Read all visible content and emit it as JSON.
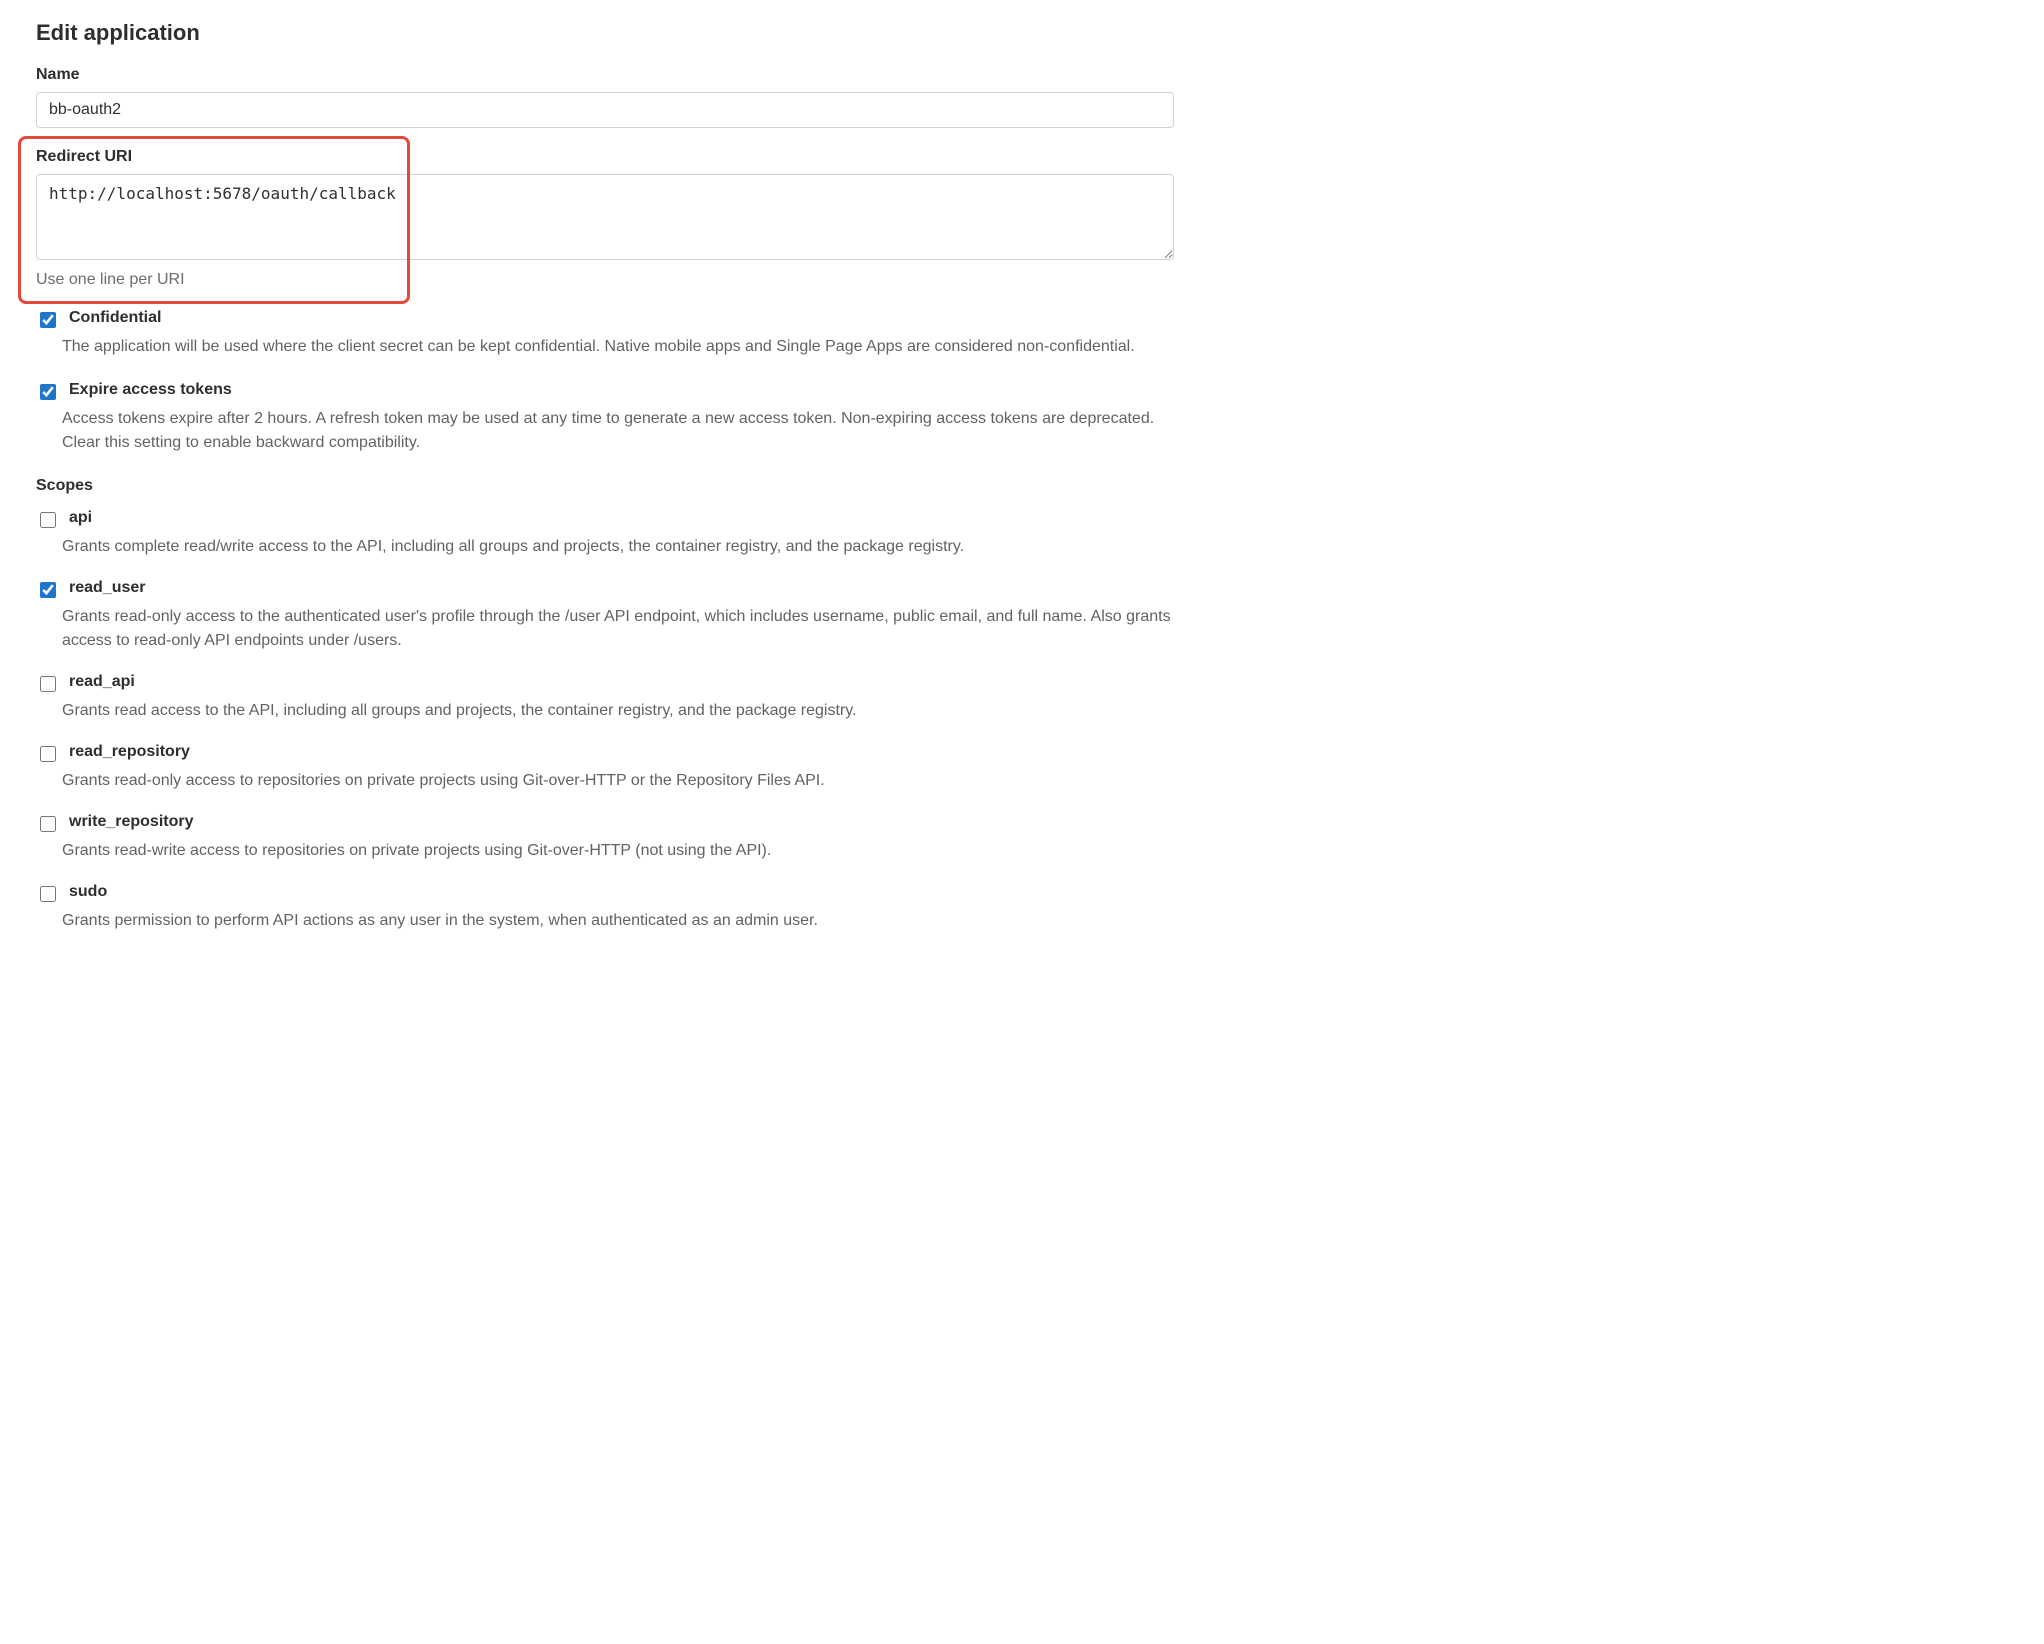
{
  "title": "Edit application",
  "name_field": {
    "label": "Name",
    "value": "bb-oauth2"
  },
  "redirect_field": {
    "label": "Redirect URI",
    "value": "http://localhost:5678/oauth/callback",
    "help": "Use one line per URI"
  },
  "confidential": {
    "label": "Confidential",
    "checked": true,
    "desc": "The application will be used where the client secret can be kept confidential. Native mobile apps and Single Page Apps are considered non-confidential."
  },
  "expire_tokens": {
    "label": "Expire access tokens",
    "checked": true,
    "desc": "Access tokens expire after 2 hours. A refresh token may be used at any time to generate a new access token. Non-expiring access tokens are deprecated. Clear this setting to enable backward compatibility."
  },
  "scopes_heading": "Scopes",
  "scopes": [
    {
      "key": "api",
      "label": "api",
      "checked": false,
      "highlighted": false,
      "desc": "Grants complete read/write access to the API, including all groups and projects, the container registry, and the package registry."
    },
    {
      "key": "read_user",
      "label": "read_user",
      "checked": true,
      "highlighted": true,
      "desc": "Grants read-only access to the authenticated user's profile through the /user API endpoint, which includes username, public email, and full name. Also grants access to read-only API endpoints under /users."
    },
    {
      "key": "read_api",
      "label": "read_api",
      "checked": false,
      "highlighted": false,
      "desc": "Grants read access to the API, including all groups and projects, the container registry, and the package registry."
    },
    {
      "key": "read_repository",
      "label": "read_repository",
      "checked": false,
      "highlighted": false,
      "desc": "Grants read-only access to repositories on private projects using Git-over-HTTP or the Repository Files API."
    },
    {
      "key": "write_repository",
      "label": "write_repository",
      "checked": false,
      "highlighted": false,
      "desc": "Grants read-write access to repositories on private projects using Git-over-HTTP (not using the API)."
    },
    {
      "key": "sudo",
      "label": "sudo",
      "checked": false,
      "highlighted": false,
      "desc": "Grants permission to perform API actions as any user in the system, when authenticated as an admin user."
    }
  ]
}
